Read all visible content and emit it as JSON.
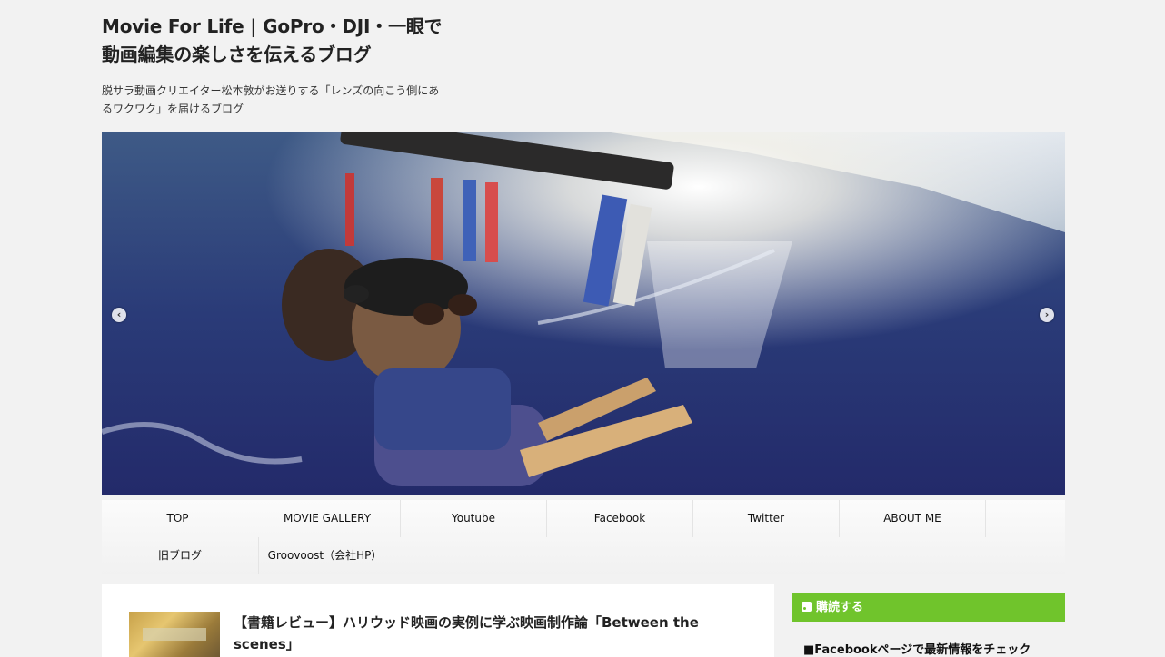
{
  "header": {
    "title_line1": "Movie For Life | GoPro・DJI・一眼で",
    "title_line2": "動画編集の楽しさを伝えるブログ",
    "description": "脱サラ動画クリエイター松本敦がお送りする「レンズの向こう側にあるワクワク」を届けるブログ"
  },
  "slider": {
    "prev_icon": "chevron-left-icon",
    "next_icon": "chevron-right-icon"
  },
  "nav": {
    "row1": [
      "TOP",
      "MOVIE GALLERY",
      "Youtube",
      "Facebook",
      "Twitter",
      "ABOUT ME"
    ],
    "row2": [
      "旧ブログ",
      "Groovoost（会社HP）"
    ]
  },
  "post": {
    "title": "【書籍レビュー】ハリウッド映画の実例に学ぶ映画制作論「Between the scenes」"
  },
  "sidebar": {
    "heading": "購読する",
    "text": "■Facebookページで最新情報をチェック",
    "accent": "#70c42c"
  }
}
